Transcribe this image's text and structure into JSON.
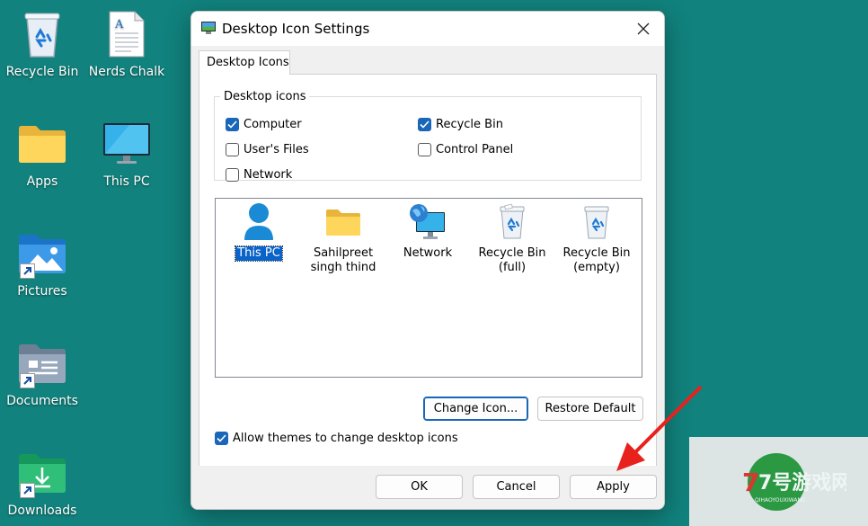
{
  "desktop": {
    "icons": [
      {
        "label": "Recycle Bin",
        "icon": "recycle-bin-icon"
      },
      {
        "label": "Nerds Chalk",
        "icon": "document-icon"
      },
      {
        "label": "Apps",
        "icon": "folder-icon"
      },
      {
        "label": "This PC",
        "icon": "monitor-icon"
      },
      {
        "label": "Pictures",
        "icon": "pictures-folder-icon"
      },
      {
        "label": "Documents",
        "icon": "documents-folder-icon"
      },
      {
        "label": "Downloads",
        "icon": "downloads-folder-icon"
      }
    ]
  },
  "dialog": {
    "title": "Desktop Icon Settings",
    "tab_label": "Desktop Icons",
    "group_label": "Desktop icons",
    "checkboxes": [
      {
        "label": "Computer",
        "checked": true
      },
      {
        "label": "Recycle Bin",
        "checked": true
      },
      {
        "label": "User's Files",
        "checked": false
      },
      {
        "label": "Control Panel",
        "checked": false
      },
      {
        "label": "Network",
        "checked": false
      }
    ],
    "icon_list": [
      {
        "label": "This PC",
        "selected": true,
        "icon": "user-icon"
      },
      {
        "label": "Sahilpreet singh thind",
        "selected": false,
        "icon": "folder-icon"
      },
      {
        "label": "Network",
        "selected": false,
        "icon": "network-icon"
      },
      {
        "label": "Recycle Bin (full)",
        "selected": false,
        "icon": "recycle-bin-full-icon"
      },
      {
        "label": "Recycle Bin (empty)",
        "selected": false,
        "icon": "recycle-bin-empty-icon"
      }
    ],
    "change_icon_label": "Change Icon...",
    "restore_default_label": "Restore Default",
    "allow_themes_label": "Allow themes to change desktop icons",
    "allow_themes_checked": true,
    "ok_label": "OK",
    "cancel_label": "Cancel",
    "apply_label": "Apply"
  },
  "watermark": {
    "text": "7号游戏网",
    "subtext": "QIHAOYOUXIWANG"
  },
  "colors": {
    "desktop": "#11827d",
    "accent": "#1a66b8",
    "annotation_arrow": "#e8211c"
  }
}
